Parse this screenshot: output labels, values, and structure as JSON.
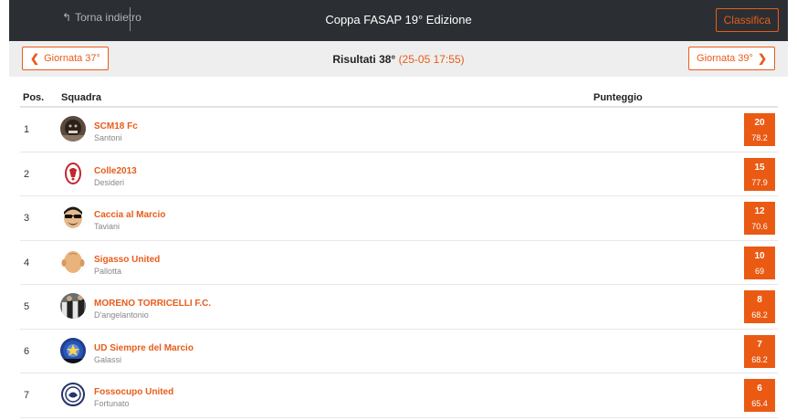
{
  "header": {
    "back_label": "Torna indietro",
    "title": "Coppa FASAP 19° Edizione",
    "classifica_label": "Classifica"
  },
  "subheader": {
    "prev_label": "Giornata 37°",
    "next_label": "Giornata 39°",
    "results_label": "Risultati 38°",
    "results_timestamp": "(25-05 17:55)"
  },
  "table": {
    "columns": {
      "pos": "Pos.",
      "team": "Squadra",
      "score": "Punteggio"
    },
    "rows": [
      {
        "pos": "1",
        "team": "SCM18 Fc",
        "owner": "Santoni",
        "points": "20",
        "total": "78.2",
        "avatar": "dark-face-avatar"
      },
      {
        "pos": "2",
        "team": "Colle2013",
        "owner": "Desideri",
        "points": "15",
        "total": "77.9",
        "avatar": "red-crest-avatar"
      },
      {
        "pos": "3",
        "team": "Caccia al Marcio",
        "owner": "Taviani",
        "points": "12",
        "total": "70.6",
        "avatar": "sunglasses-face-avatar"
      },
      {
        "pos": "4",
        "team": "Sigasso United",
        "owner": "Pallotta",
        "points": "10",
        "total": "69",
        "avatar": "bald-head-avatar"
      },
      {
        "pos": "5",
        "team": "MORENO TORRICELLI F.C.",
        "owner": "D'angelantonio",
        "points": "8",
        "total": "68.2",
        "avatar": "group-photo-avatar"
      },
      {
        "pos": "6",
        "team": "UD Siempre del Marcio",
        "owner": "Galassi",
        "points": "7",
        "total": "68.2",
        "avatar": "blue-crest-avatar"
      },
      {
        "pos": "7",
        "team": "Fossocupo United",
        "owner": "Fortunato",
        "points": "6",
        "total": "65.4",
        "avatar": "navy-crest-avatar"
      }
    ]
  },
  "colors": {
    "accent": "#ea5a13",
    "topbar": "#2b2f33",
    "subbar": "#eeeeee"
  }
}
